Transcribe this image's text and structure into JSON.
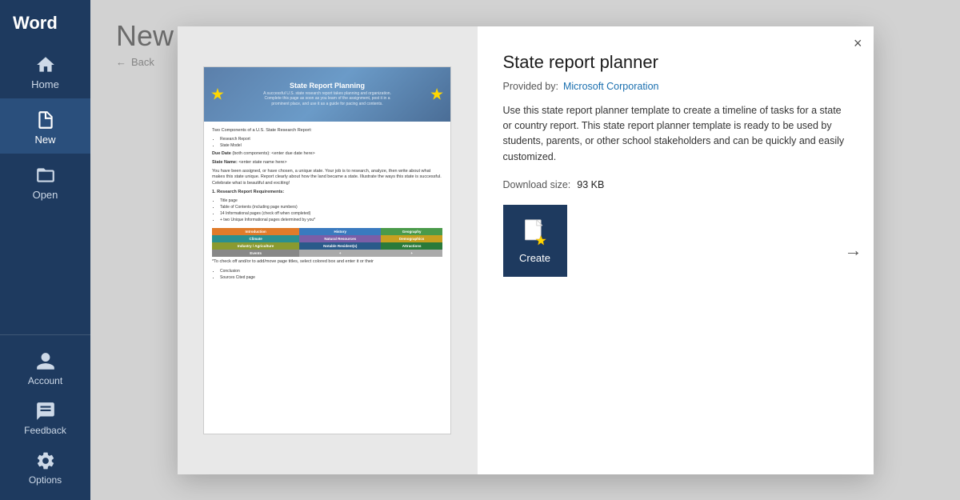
{
  "app": {
    "title": "Word"
  },
  "sidebar": {
    "items": [
      {
        "id": "home",
        "label": "Home",
        "active": false
      },
      {
        "id": "new",
        "label": "New",
        "active": true
      },
      {
        "id": "open",
        "label": "Open",
        "active": false
      }
    ],
    "bottom_items": [
      {
        "id": "account",
        "label": "Account"
      },
      {
        "id": "feedback",
        "label": "Feedback"
      },
      {
        "id": "options",
        "label": "Options"
      }
    ]
  },
  "main": {
    "title": "New",
    "back_label": "Back"
  },
  "dialog": {
    "close_label": "×",
    "template_title": "State report planner",
    "provider_label": "Provided by:",
    "provider_name": "Microsoft Corporation",
    "description": "Use this state report planner template to create a timeline of tasks for a state or country report. This state report planner template is ready to be used by students, parents, or other school stakeholders and can be quickly and easily customized.",
    "download_label": "Download size:",
    "download_size": "93 KB",
    "create_label": "Create",
    "nav_next": "→",
    "preview": {
      "main_title": "State Report Planning",
      "main_sub": "A successful U.S. state research report takes planning and organization.\nComplete this page as soon as you learn of the assignment, post it in a\nprominent place, and use it as a guide for pacing and contents.",
      "section_heading": "Two Components of a U.S. State Research Report:",
      "bullet1": "Research Report",
      "bullet2": "State Model",
      "due_date": "Due Date (both components): <enter due date here>",
      "state_name": "State Name: <enter state name here>",
      "body_text": "You have been assigned, or have chosen, a unique state. Your job is to research, analyze, then write about what makes this state unique. Report clearly about how the land became a state. Illustrate the ways this state is successful. Celebrate what is beautiful and exciting!",
      "req_heading": "1. Research Report Requirements:",
      "req_items": [
        "Title page",
        "Table of Contents (including page numbers)",
        "14 Informational pages (check off when completed)",
        "+ two Unique Informational pages determined by you*"
      ],
      "table_note": "*To check off and/or to add/move page titles, select colored box and enter it or their",
      "conclusion": "Conclusion",
      "sources": "Sources Cited page"
    }
  }
}
